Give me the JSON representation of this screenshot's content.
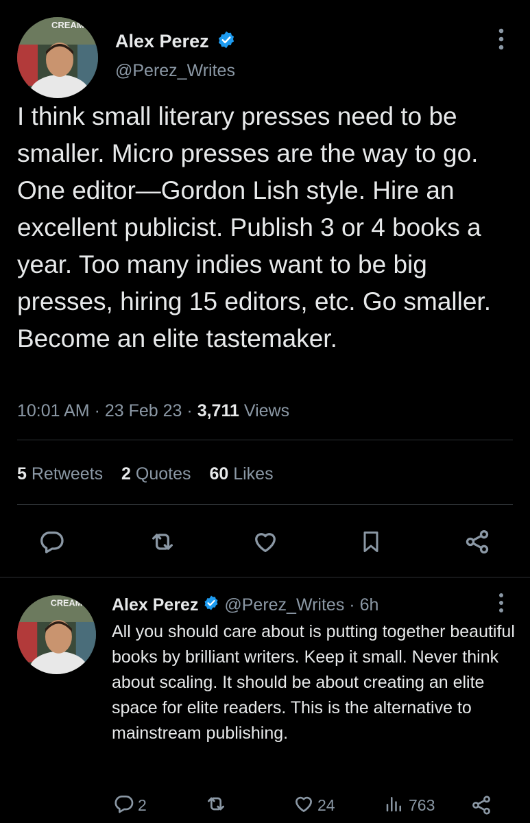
{
  "main_tweet": {
    "author_name": "Alex Perez",
    "author_handle": "@Perez_Writes",
    "avatar_sign": "CREAM",
    "text": "I think small literary presses need to be smaller. Micro presses are the way to go. One editor—Gordon Lish style. Hire an excellent publicist. Publish 3 or 4 books a year. Too many indies want to be big presses, hiring 15 editors, etc. Go smaller. Become an elite tastemaker.",
    "time": "10:01 AM",
    "date": "23 Feb 23",
    "views_count": "3,711",
    "views_label": "Views",
    "separator": "·"
  },
  "stats": {
    "retweets_count": "5",
    "retweets_label": "Retweets",
    "quotes_count": "2",
    "quotes_label": "Quotes",
    "likes_count": "60",
    "likes_label": "Likes"
  },
  "action_bar": {
    "icons": [
      "reply-icon",
      "retweet-icon",
      "like-icon",
      "bookmark-icon",
      "share-icon"
    ]
  },
  "reply": {
    "author_name": "Alex Perez",
    "author_handle": "@Perez_Writes",
    "time_ago": "· 6h",
    "avatar_sign": "CREAM",
    "text": "All you should care about is putting together beautiful books by brilliant writers. Keep it small. Never think about scaling. It should be about creating an elite space for elite readers. This is the alternative to mainstream publishing.",
    "reply_count": "2",
    "like_count": "24",
    "view_count": "763"
  },
  "colors": {
    "background": "#000000",
    "text": "#e7e9ea",
    "muted": "#8b98a5",
    "divider": "#2f3336",
    "verified": "#1d9bf0"
  }
}
